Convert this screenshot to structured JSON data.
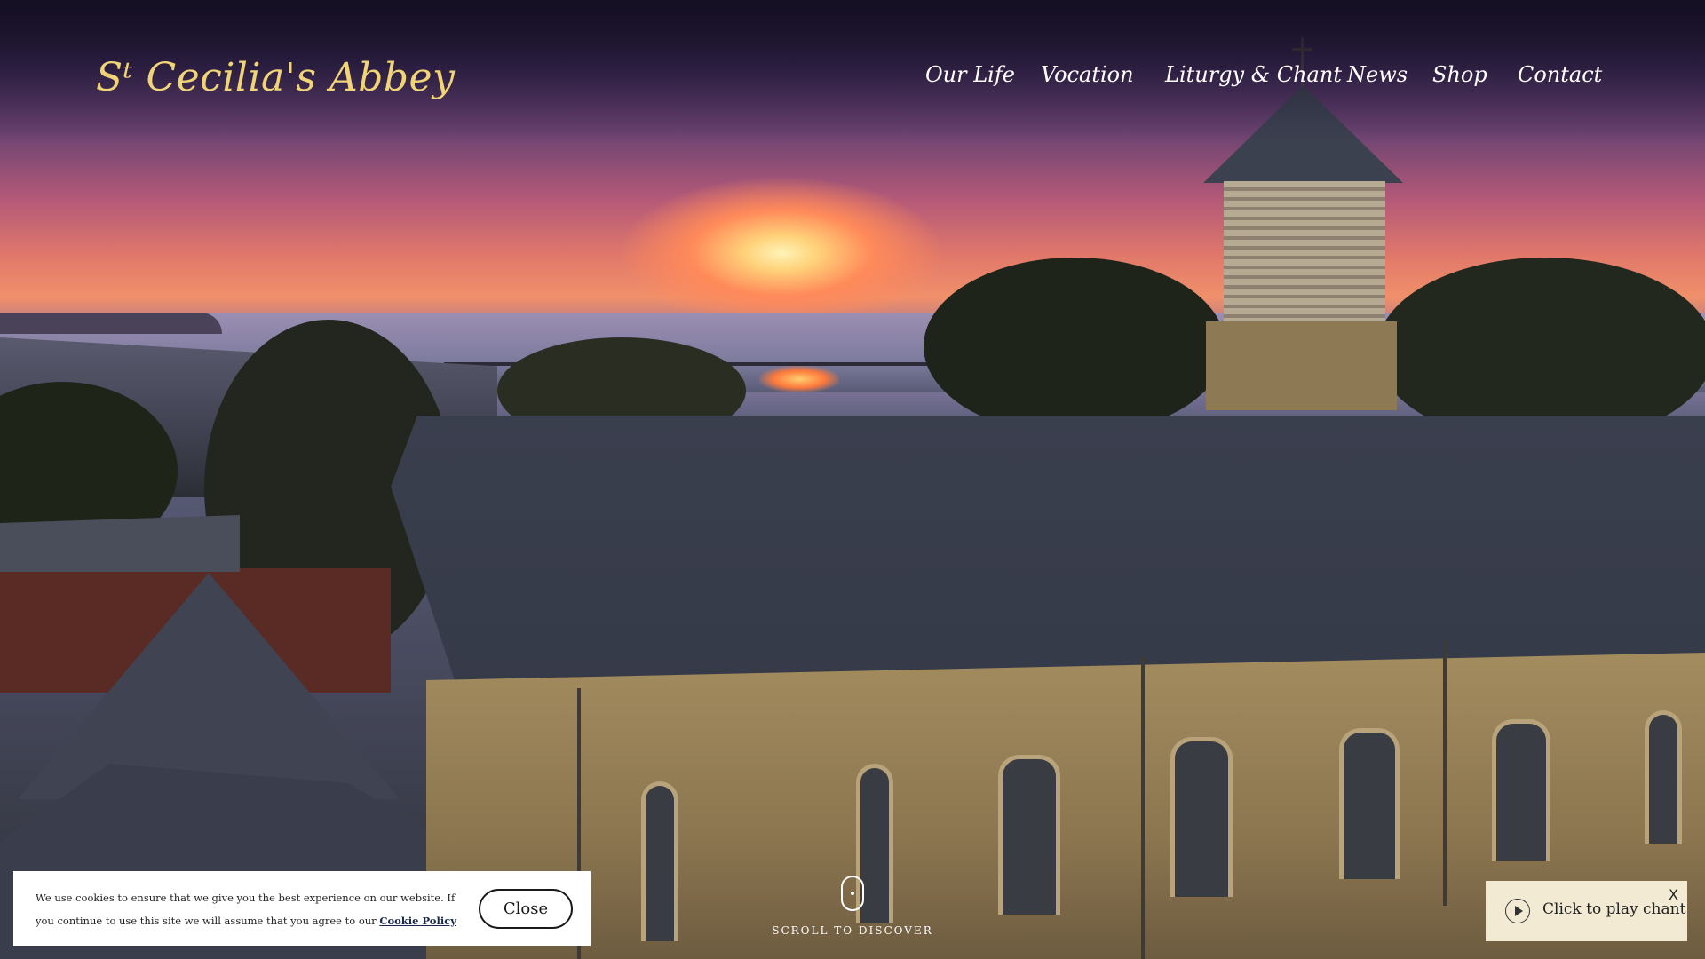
{
  "header": {
    "logo_text": "Sᵗ Cecilia's Abbey",
    "nav": [
      {
        "label": "Our Life"
      },
      {
        "label": "Vocation"
      },
      {
        "label": "Liturgy & Chant"
      },
      {
        "label": "News"
      },
      {
        "label": "Shop"
      },
      {
        "label": "Contact"
      }
    ]
  },
  "hero": {
    "scroll_label": "SCROLL TO DISCOVER",
    "scroll_icon": "mouse-scroll-icon"
  },
  "cookie_banner": {
    "text": "We use cookies to ensure that we give you the best experience on our website. If you continue to use this site we will assume that you agree to our",
    "link_text": "Cookie Policy",
    "close_label": "Close"
  },
  "chant_widget": {
    "icon": "play-circle-icon",
    "label": "Click to play chant",
    "close_label": "X"
  },
  "colors": {
    "logo_gold": "#f1d477",
    "nav_text": "#ffffff",
    "chant_bg": "#f3ead3",
    "cookie_bg": "#ffffff"
  }
}
